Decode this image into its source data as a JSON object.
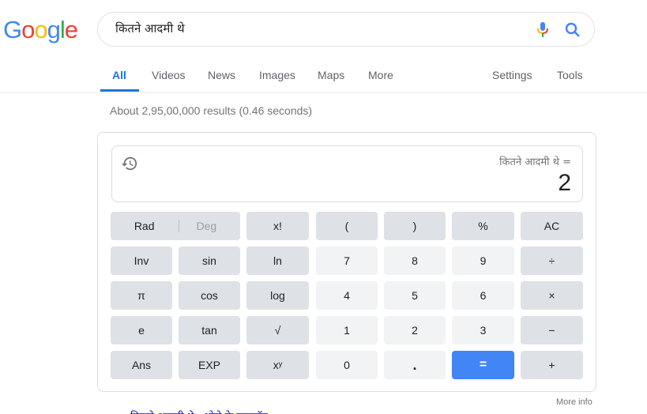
{
  "logo": {
    "letters": [
      "G",
      "o",
      "o",
      "g",
      "l",
      "e"
    ],
    "colors": [
      "#4285f4",
      "#ea4335",
      "#fbbc05",
      "#4285f4",
      "#34a853",
      "#ea4335"
    ]
  },
  "search": {
    "query": "कितने आदमी थे",
    "mic_icon": "microphone-icon",
    "search_icon": "magnifier-icon"
  },
  "tabs": {
    "items": [
      {
        "label": "All",
        "active": true
      },
      {
        "label": "Videos"
      },
      {
        "label": "News"
      },
      {
        "label": "Images"
      },
      {
        "label": "Maps"
      },
      {
        "label": "More"
      }
    ],
    "settings": "Settings",
    "tools": "Tools"
  },
  "stats": "About 2,95,00,000 results (0.46 seconds)",
  "calculator": {
    "history_icon": "history-icon",
    "expression": "कितने आदमी थे =",
    "result": "2",
    "keys": {
      "rad": "Rad",
      "deg": "Deg",
      "fact": "x!",
      "lparen": "(",
      "rparen": ")",
      "percent": "%",
      "ac": "AC",
      "inv": "Inv",
      "sin": "sin",
      "ln": "ln",
      "seven": "7",
      "eight": "8",
      "nine": "9",
      "divide": "÷",
      "pi": "π",
      "cos": "cos",
      "log": "log",
      "four": "4",
      "five": "5",
      "six": "6",
      "multiply": "×",
      "e": "e",
      "tan": "tan",
      "sqrt": "√",
      "one": "1",
      "two": "2",
      "three": "3",
      "minus": "−",
      "ans": "Ans",
      "exp": "EXP",
      "pow": "xʸ",
      "zero": "0",
      "dot": ".",
      "equals": "=",
      "plus": "+"
    },
    "equals_color": "#4285f4"
  },
  "more_info": "More info",
  "cutoff_link": "कितने आदमी थे - शोले के डायलॉग"
}
